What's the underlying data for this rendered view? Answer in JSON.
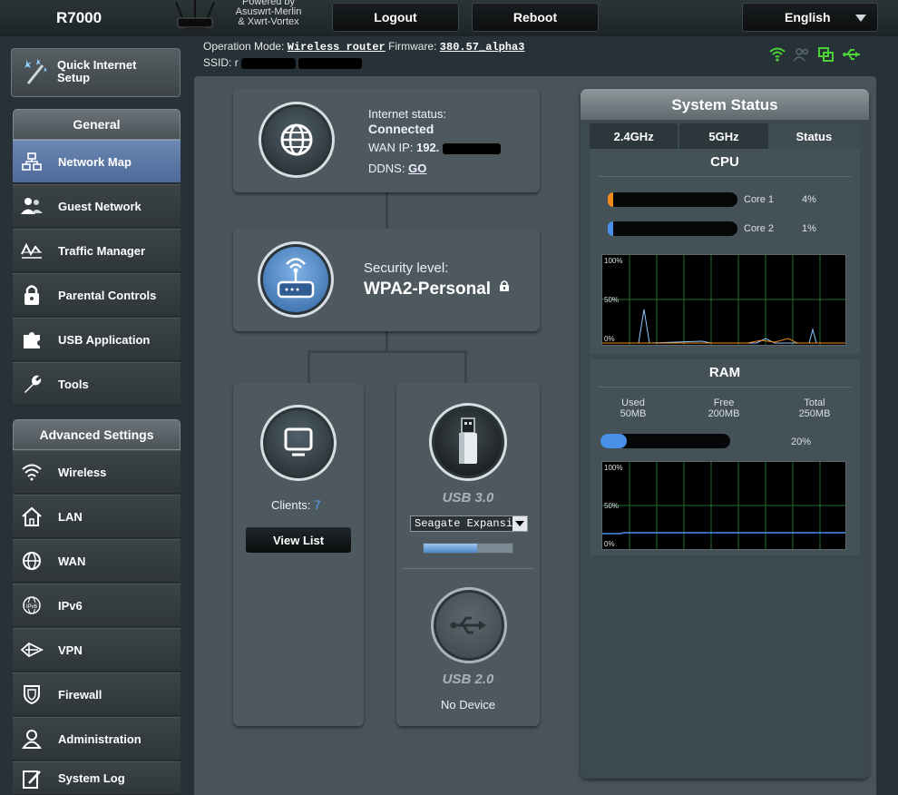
{
  "header": {
    "model": "R7000",
    "powered_line1": "Powered by",
    "powered_line2": "Asuswrt-Merlin",
    "powered_line3": "& Xwrt-Vortex",
    "logout_label": "Logout",
    "reboot_label": "Reboot",
    "language_label": "English"
  },
  "info": {
    "opmode_label": "Operation Mode:",
    "opmode_value": "Wireless router",
    "firmware_label": "Firmware:",
    "firmware_value": "380.57_alpha3",
    "ssid_label": "SSID:",
    "ssid_value": "r"
  },
  "sidebar": {
    "quick_setup_line1": "Quick Internet",
    "quick_setup_line2": "Setup",
    "general_title": "General",
    "general_items": [
      {
        "label": "Network Map"
      },
      {
        "label": "Guest Network"
      },
      {
        "label": "Traffic Manager"
      },
      {
        "label": "Parental Controls"
      },
      {
        "label": "USB Application"
      },
      {
        "label": "Tools"
      }
    ],
    "advanced_title": "Advanced Settings",
    "advanced_items": [
      {
        "label": "Wireless"
      },
      {
        "label": "LAN"
      },
      {
        "label": "WAN"
      },
      {
        "label": "IPv6"
      },
      {
        "label": "VPN"
      },
      {
        "label": "Firewall"
      },
      {
        "label": "Administration"
      },
      {
        "label": "System Log"
      }
    ]
  },
  "map": {
    "internet_status_label": "Internet status:",
    "internet_status_value": "Connected",
    "wan_ip_label": "WAN IP:",
    "wan_ip_value": "192.",
    "ddns_label": "DDNS:",
    "ddns_link": "GO",
    "security_label": "Security level:",
    "security_value": "WPA2-Personal",
    "clients_label": "Clients:",
    "clients_count": "7",
    "view_list_label": "View List",
    "usb3_label": "USB 3.0",
    "usb3_device": "Seagate Expansi",
    "usb3_usage": 0.6,
    "usb2_label": "USB 2.0",
    "usb2_device": "No Device"
  },
  "system_status": {
    "title": "System Status",
    "tabs": [
      {
        "label": "2.4GHz"
      },
      {
        "label": "5GHz"
      },
      {
        "label": "Status"
      }
    ],
    "cpu_title": "CPU",
    "cores": [
      {
        "label": "Core 1",
        "percent": "4%",
        "value": 0.04
      },
      {
        "label": "Core 2",
        "percent": "1%",
        "value": 0.01
      }
    ],
    "graph_100": "100%",
    "graph_50": "50%",
    "graph_0": "0%",
    "ram_title": "RAM",
    "ram_used_label": "Used",
    "ram_used_value": "50MB",
    "ram_free_label": "Free",
    "ram_free_value": "200MB",
    "ram_total_label": "Total",
    "ram_total_value": "250MB",
    "ram_percent": "20%",
    "ram_value": 0.2
  },
  "colors": {
    "accent_blue": "#4a90e8",
    "cpu_orange": "#f08a1c",
    "graph_green": "#1f6e2c",
    "status_green": "#4cd137"
  }
}
